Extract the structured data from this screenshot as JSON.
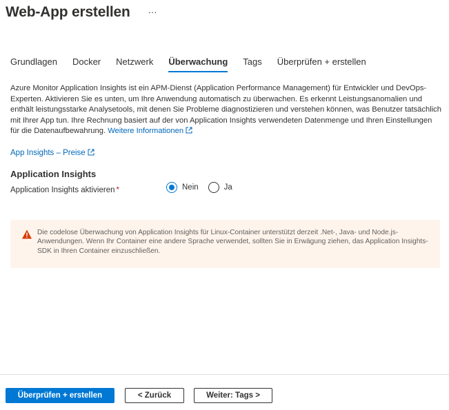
{
  "header": {
    "title": "Web-App erstellen",
    "more_label": "···"
  },
  "tabs": [
    {
      "label": "Grundlagen",
      "active": false
    },
    {
      "label": "Docker",
      "active": false
    },
    {
      "label": "Netzwerk",
      "active": false
    },
    {
      "label": "Überwachung",
      "active": true
    },
    {
      "label": "Tags",
      "active": false
    },
    {
      "label": "Überprüfen + erstellen",
      "active": false
    }
  ],
  "description": {
    "text": "Azure Monitor Application Insights ist ein APM-Dienst (Application Performance Management) für Entwickler und DevOps-Experten. Aktivieren Sie es unten, um Ihre Anwendung automatisch zu überwachen. Es erkennt Leistungsanomalien und enthält leistungsstarke Analysetools, mit denen Sie Probleme diagnostizieren und verstehen können, was Benutzer tatsächlich mit Ihrer App tun. Ihre Rechnung basiert auf der von Application Insights verwendeten Datenmenge und Ihren Einstellungen für die Datenaufbewahrung.",
    "link_label": "Weitere Informationen"
  },
  "pricing_link": "App Insights – Preise",
  "section": {
    "title": "Application Insights",
    "field_label": "Application Insights aktivieren",
    "required_mark": "*",
    "options": [
      {
        "label": "Nein",
        "checked": true
      },
      {
        "label": "Ja",
        "checked": false
      }
    ]
  },
  "warning": {
    "icon": "warning-icon",
    "text": "Die codelose Überwachung von Application Insights für Linux-Container unterstützt derzeit .Net-, Java- und Node.js-Anwendungen. Wenn Ihr Container eine andere Sprache verwendet, sollten Sie in Erwägung ziehen, das Application Insights-SDK in Ihren Container einzuschließen."
  },
  "footer": {
    "primary_label": "Überprüfen + erstellen",
    "back_label": "< Zurück",
    "next_label": "Weiter: Tags >"
  },
  "colors": {
    "accent": "#0078d4",
    "link": "#0067b8",
    "warning_bg": "#fff4ec",
    "warning_icon": "#d83b01"
  }
}
